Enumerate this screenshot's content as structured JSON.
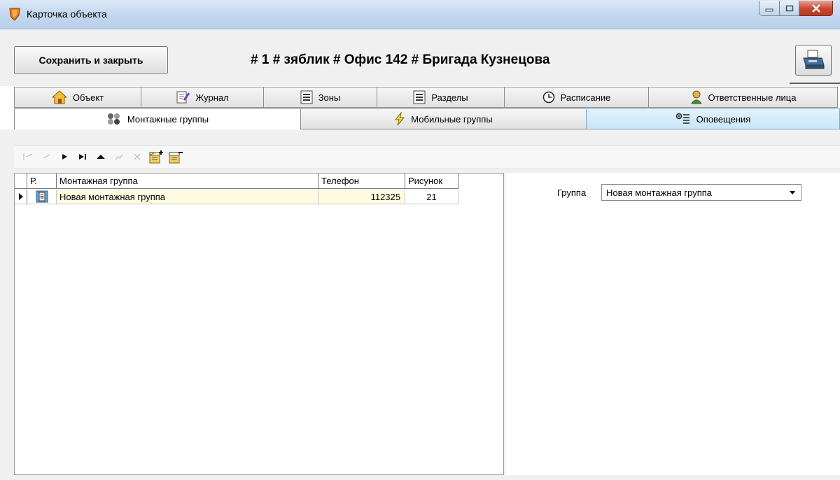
{
  "window": {
    "title": "Карточка объекта"
  },
  "header": {
    "save_label": "Сохранить и закрыть",
    "title": "# 1 # зяблик # Офис 142 # Бригада Кузнецова"
  },
  "tabs_row1": [
    {
      "label": "Объект",
      "icon": "house-icon"
    },
    {
      "label": "Журнал",
      "icon": "journal-icon"
    },
    {
      "label": "Зоны",
      "icon": "list-icon"
    },
    {
      "label": "Разделы",
      "icon": "list-icon"
    },
    {
      "label": "Расписание",
      "icon": "clock-icon"
    },
    {
      "label": "Ответственные лица",
      "icon": "person-icon"
    }
  ],
  "tabs_row2": [
    {
      "label": "Монтажные группы",
      "icon": "install-groups-icon",
      "state": "active"
    },
    {
      "label": "Мобильные группы",
      "icon": "lightning-icon",
      "state": "normal"
    },
    {
      "label": "Оповещения",
      "icon": "notification-icon",
      "state": "hover"
    }
  ],
  "toolbar": {
    "buttons": [
      "first-icon",
      "prior-icon",
      "next-icon",
      "last-icon",
      "insert-icon",
      "edit-icon",
      "cancel-icon",
      "add-record-icon",
      "delete-record-icon"
    ]
  },
  "grid": {
    "columns": [
      "Р.",
      "Монтажная группа",
      "Телефон",
      "Рисунок"
    ],
    "rows": [
      {
        "name": "Новая монтажная группа",
        "phone": "112325",
        "picture": "21"
      }
    ]
  },
  "group": {
    "label": "Группа",
    "value": "Новая монтажная группа"
  },
  "colors": {
    "titlebar": "#c6d9ef",
    "selected_row": "#fffbe1",
    "highlight_tab": "#c8e6f6"
  }
}
